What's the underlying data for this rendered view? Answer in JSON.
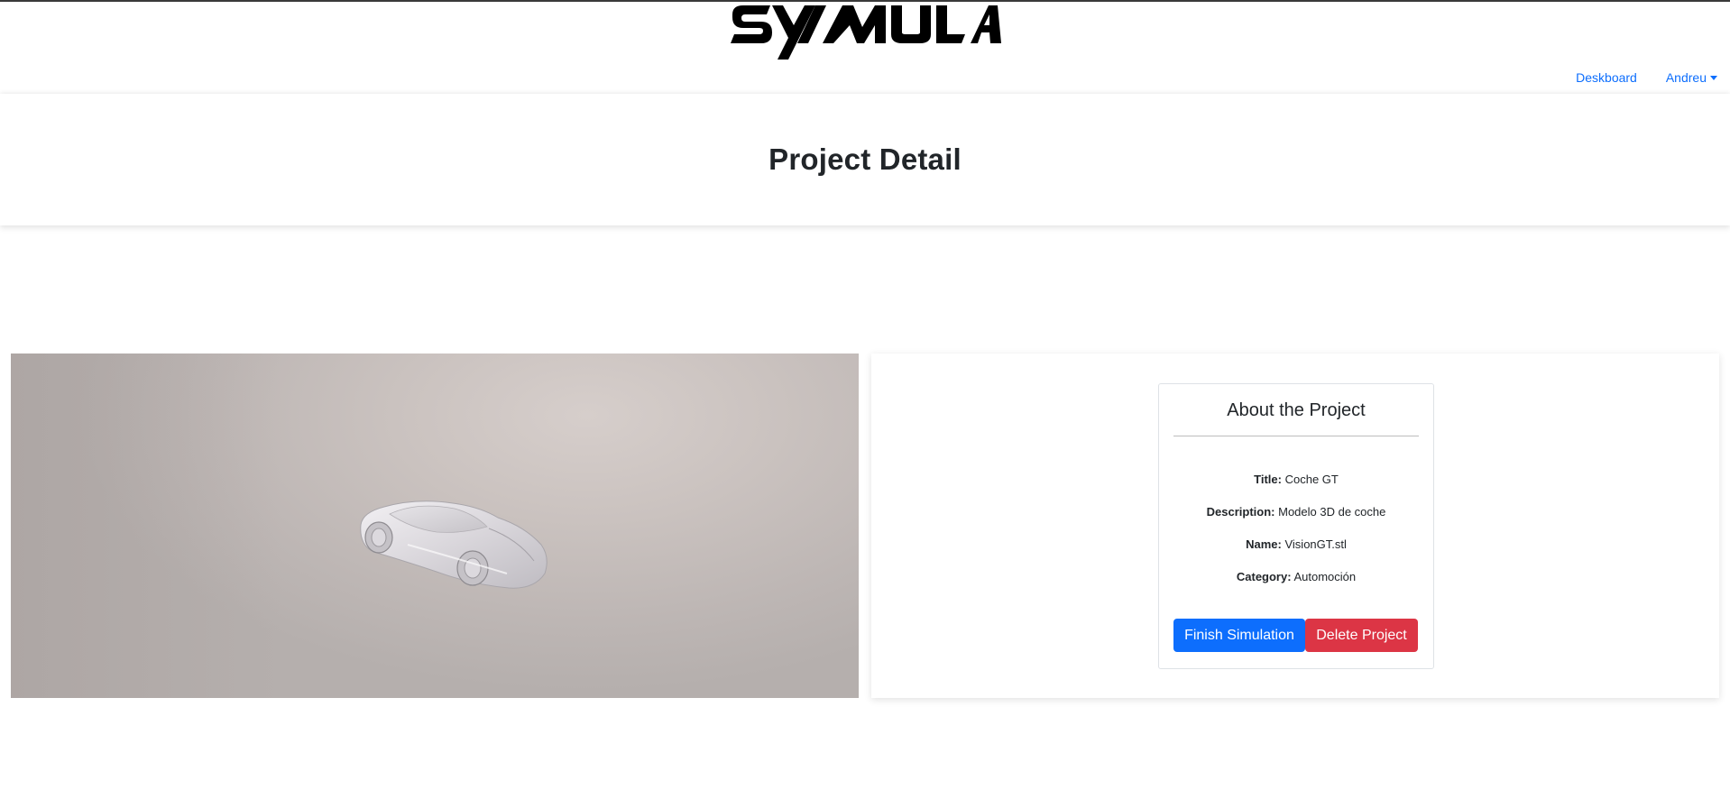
{
  "nav": {
    "logo_text": "SYMULA",
    "links": [
      {
        "label": "Deskboard"
      },
      {
        "label": "Andreu",
        "dropdown": true
      }
    ]
  },
  "header": {
    "title": "Project Detail"
  },
  "viewer": {
    "model_icon": "car-3d-model"
  },
  "card": {
    "title": "About the Project",
    "fields": [
      {
        "label": "Title:",
        "value": "Coche GT"
      },
      {
        "label": "Description:",
        "value": "Modelo 3D de coche"
      },
      {
        "label": "Name:",
        "value": "VisionGT.stl"
      },
      {
        "label": "Category:",
        "value": "Automoción"
      }
    ],
    "buttons": {
      "finish": "Finish Simulation",
      "delete": "Delete Project"
    }
  },
  "colors": {
    "link": "#0d6efd",
    "primary": "#0d6efd",
    "danger": "#dc3545"
  }
}
